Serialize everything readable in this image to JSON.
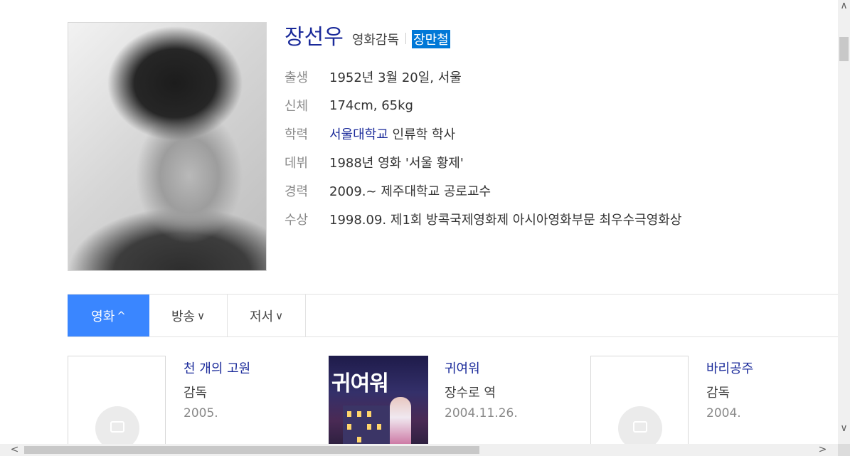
{
  "profile": {
    "name": "장선우",
    "job": "영화감독",
    "alias": "장만철",
    "info": [
      {
        "label": "출생",
        "value": "1952년 3월 20일, 서울"
      },
      {
        "label": "신체",
        "value": "174cm, 65kg"
      },
      {
        "label": "학력",
        "link": "서울대학교",
        "value": " 인류학 학사"
      },
      {
        "label": "데뷔",
        "value": "1988년 영화 '서울 황제'"
      },
      {
        "label": "경력",
        "value": "2009.~ 제주대학교 공로교수"
      },
      {
        "label": "수상",
        "value": "1998.09. 제1회 방콕국제영화제 아시아영화부문 최우수극영화상"
      }
    ]
  },
  "tabs": [
    {
      "label": "영화",
      "chevron": "^",
      "active": true
    },
    {
      "label": "방송",
      "chevron": "∨"
    },
    {
      "label": "저서",
      "chevron": "∨"
    }
  ],
  "works": [
    {
      "title": "천 개의 고원",
      "role": "감독",
      "date": "2005.",
      "thumb": "placeholder-image-icon"
    },
    {
      "title": "귀여워",
      "role": "장수로 역",
      "date": "2004.11.26.",
      "thumb": "poster",
      "poster_text": "귀여워"
    },
    {
      "title": "바리공주",
      "role": "감독",
      "date": "2004.",
      "thumb": "placeholder-image-icon"
    }
  ],
  "scrollbars": {
    "up": "∧",
    "down": "∨",
    "left": "<",
    "right": ">"
  },
  "colors": {
    "name": "#1a2a9a",
    "active_tab": "#3a86ff",
    "alias_highlight": "#0078d7"
  }
}
